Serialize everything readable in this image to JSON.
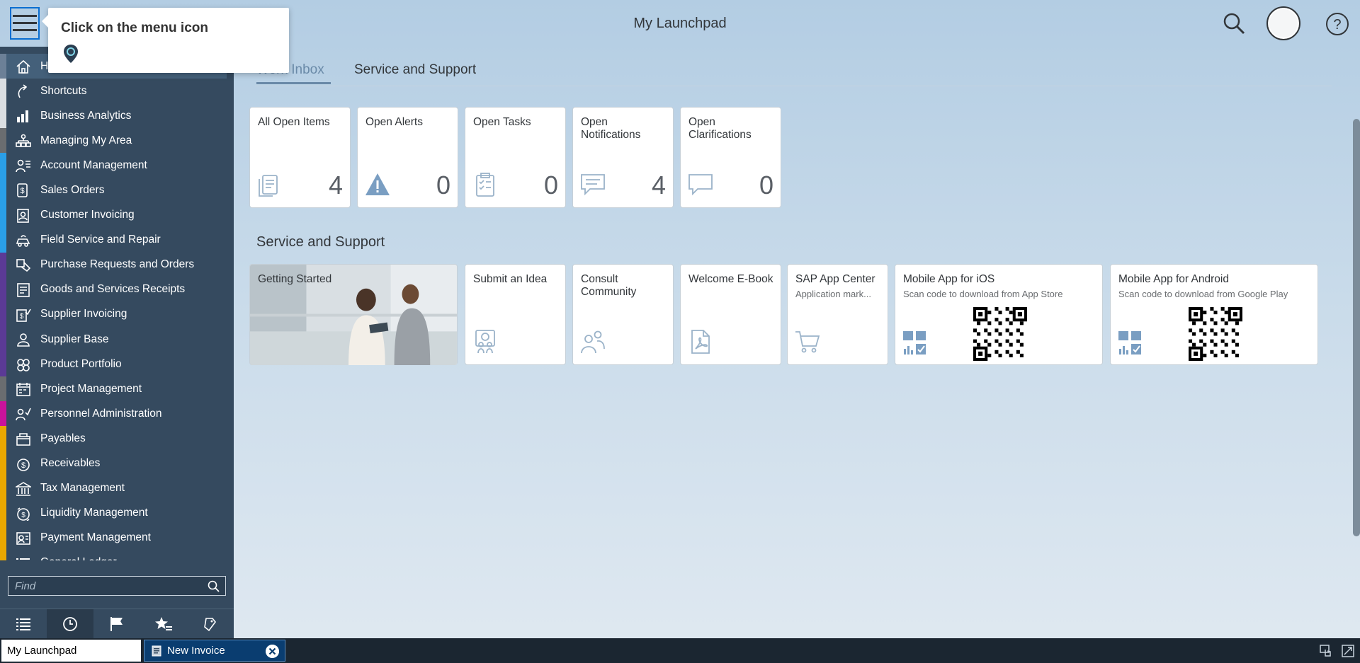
{
  "header": {
    "title": "My Launchpad"
  },
  "tooltip": {
    "text": "Click on the menu icon"
  },
  "sidebar": {
    "items": [
      {
        "label": "Home",
        "icon": "home-icon",
        "color": "#6c8097"
      },
      {
        "label": "Shortcuts",
        "icon": "shortcut-icon",
        "color": "#dadee2"
      },
      {
        "label": "Business Analytics",
        "icon": "analytics-icon",
        "color": "#dadee2"
      },
      {
        "label": "Managing My Area",
        "icon": "org-icon",
        "color": "#6a6d70"
      },
      {
        "label": "Account Management",
        "icon": "account-icon",
        "color": "#2a9fe8"
      },
      {
        "label": "Sales Orders",
        "icon": "sales-order-icon",
        "color": "#2a9fe8"
      },
      {
        "label": "Customer Invoicing",
        "icon": "invoice-icon",
        "color": "#2a9fe8"
      },
      {
        "label": "Field Service and Repair",
        "icon": "service-car-icon",
        "color": "#2a9fe8"
      },
      {
        "label": "Purchase Requests and Orders",
        "icon": "purchase-icon",
        "color": "#5b3a96"
      },
      {
        "label": "Goods and Services Receipts",
        "icon": "receipt-icon",
        "color": "#5b3a96"
      },
      {
        "label": "Supplier Invoicing",
        "icon": "supplier-invoice-icon",
        "color": "#5b3a96"
      },
      {
        "label": "Supplier Base",
        "icon": "supplier-icon",
        "color": "#5b3a96"
      },
      {
        "label": "Product Portfolio",
        "icon": "product-icon",
        "color": "#5b3a96"
      },
      {
        "label": "Project Management",
        "icon": "project-icon",
        "color": "#6a6d70"
      },
      {
        "label": "Personnel Administration",
        "icon": "personnel-icon",
        "color": "#c9129b"
      },
      {
        "label": "Payables",
        "icon": "payables-icon",
        "color": "#e9a700"
      },
      {
        "label": "Receivables",
        "icon": "receivables-icon",
        "color": "#e9a700"
      },
      {
        "label": "Tax Management",
        "icon": "tax-icon",
        "color": "#e9a700"
      },
      {
        "label": "Liquidity Management",
        "icon": "liquidity-icon",
        "color": "#e9a700"
      },
      {
        "label": "Payment Management",
        "icon": "payment-icon",
        "color": "#e9a700"
      },
      {
        "label": "General Ledger",
        "icon": "ledger-icon",
        "color": "#e9a700"
      }
    ],
    "find_placeholder": "Find"
  },
  "tabs": [
    {
      "label": "Work Inbox",
      "selected": true
    },
    {
      "label": "Service and Support",
      "selected": false
    }
  ],
  "inbox_tiles": [
    {
      "title": "All Open Items",
      "count": "4",
      "icon": "document-icon"
    },
    {
      "title": "Open Alerts",
      "count": "0",
      "icon": "alert-icon"
    },
    {
      "title": "Open Tasks",
      "count": "0",
      "icon": "task-icon"
    },
    {
      "title": "Open Notifications",
      "count": "4",
      "icon": "notification-icon"
    },
    {
      "title": "Open Clarifications",
      "count": "0",
      "icon": "clarification-icon"
    }
  ],
  "service_group": {
    "title": "Service and Support",
    "tiles": [
      {
        "title": "Getting Started",
        "icon": "photo"
      },
      {
        "title": "Submit an Idea",
        "icon": "idea-icon"
      },
      {
        "title": "Consult Community",
        "icon": "community-icon"
      },
      {
        "title": "Welcome E-Book",
        "icon": "pdf-icon"
      },
      {
        "title": "SAP App Center",
        "subtitle": "Application mark...",
        "icon": "cart-icon"
      },
      {
        "title": "Mobile App for iOS",
        "subtitle": "Scan code to download from App Store",
        "icon": "qr-code-icon"
      },
      {
        "title": "Mobile App for Android",
        "subtitle": "Scan code to download from Google Play",
        "icon": "qr-code-icon"
      }
    ]
  },
  "taskbar": {
    "tasks": [
      {
        "label": "My Launchpad"
      },
      {
        "label": "New Invoice"
      }
    ]
  }
}
